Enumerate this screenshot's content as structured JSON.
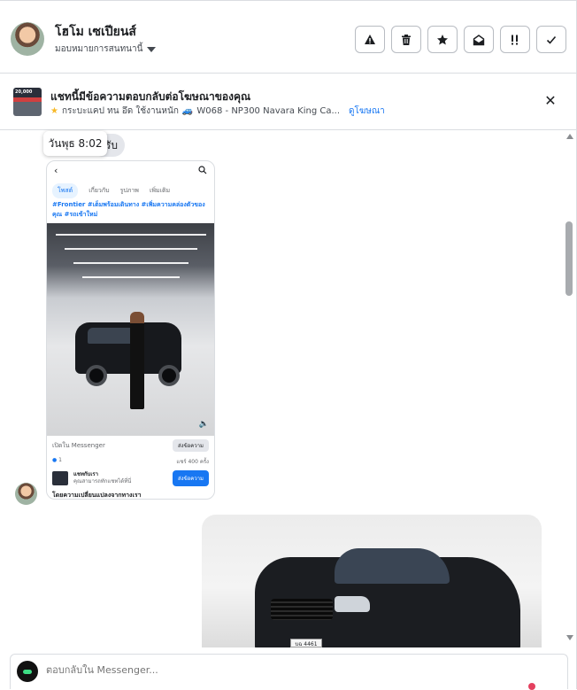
{
  "header": {
    "contact_name": "โฮโม เซเปียนส์",
    "assign_label": "มอบหมายการสนทนานี้",
    "actions": [
      {
        "name": "report-spam-button",
        "icon": "warning-icon",
        "glyph": "▲"
      },
      {
        "name": "delete-button",
        "icon": "trash-icon",
        "glyph": "🗑"
      },
      {
        "name": "star-button",
        "icon": "star-icon",
        "glyph": "★"
      },
      {
        "name": "mark-unread-button",
        "icon": "open-envelope-icon",
        "glyph": "✉"
      },
      {
        "name": "follow-up-button",
        "icon": "follow-up-icon",
        "glyph": "!!"
      },
      {
        "name": "mark-done-button",
        "icon": "check-icon",
        "glyph": "✓"
      }
    ]
  },
  "ad": {
    "title": "แชทนี้มีข้อความตอบกลับต่อโฆษณาของคุณ",
    "subtitle": "กระบะแคป ทน อึด ใช้งานหนัก",
    "ad_code": "W068 - NP300 Navara King Ca...",
    "view_ad_link": "ดูโฆษณา",
    "thumb_label": "20,000"
  },
  "conversation": {
    "timestamp_tooltip": "วันพุธ 8:02",
    "peek_text": "รับ",
    "shared_post": {
      "tabs": [
        "โพสต์",
        "เกี่ยวกับ",
        "รูปภาพ",
        "เพิ่มเติม"
      ],
      "hashtags": "#Frontier #เต็มพร้อมเดินทาง #เพิ่มความคล่องตัวของคุณ #รถเข้าใหม่",
      "open_in_messenger": "เปิดใน Messenger",
      "send_message_small": "ส่งข้อความ",
      "reaction_count": "1",
      "comments_count": "แชร์ 400 ครั้ง",
      "page_name": "แชทกับเรา",
      "page_sub": "คุณสามารถทักแชทได้ที่นี่",
      "message_button": "ส่งข้อความ",
      "truncated_caption": "โดยความเปลี่ยนแปลงจากทางเรา"
    },
    "photo_plate": "บฉ 4461"
  },
  "composer": {
    "placeholder": "ตอบกลับใน Messenger..."
  },
  "colors": {
    "accent": "#1877f2",
    "border": "#dadde1",
    "reaction_pink": "#e4405f",
    "star_yellow": "#f7b928"
  }
}
